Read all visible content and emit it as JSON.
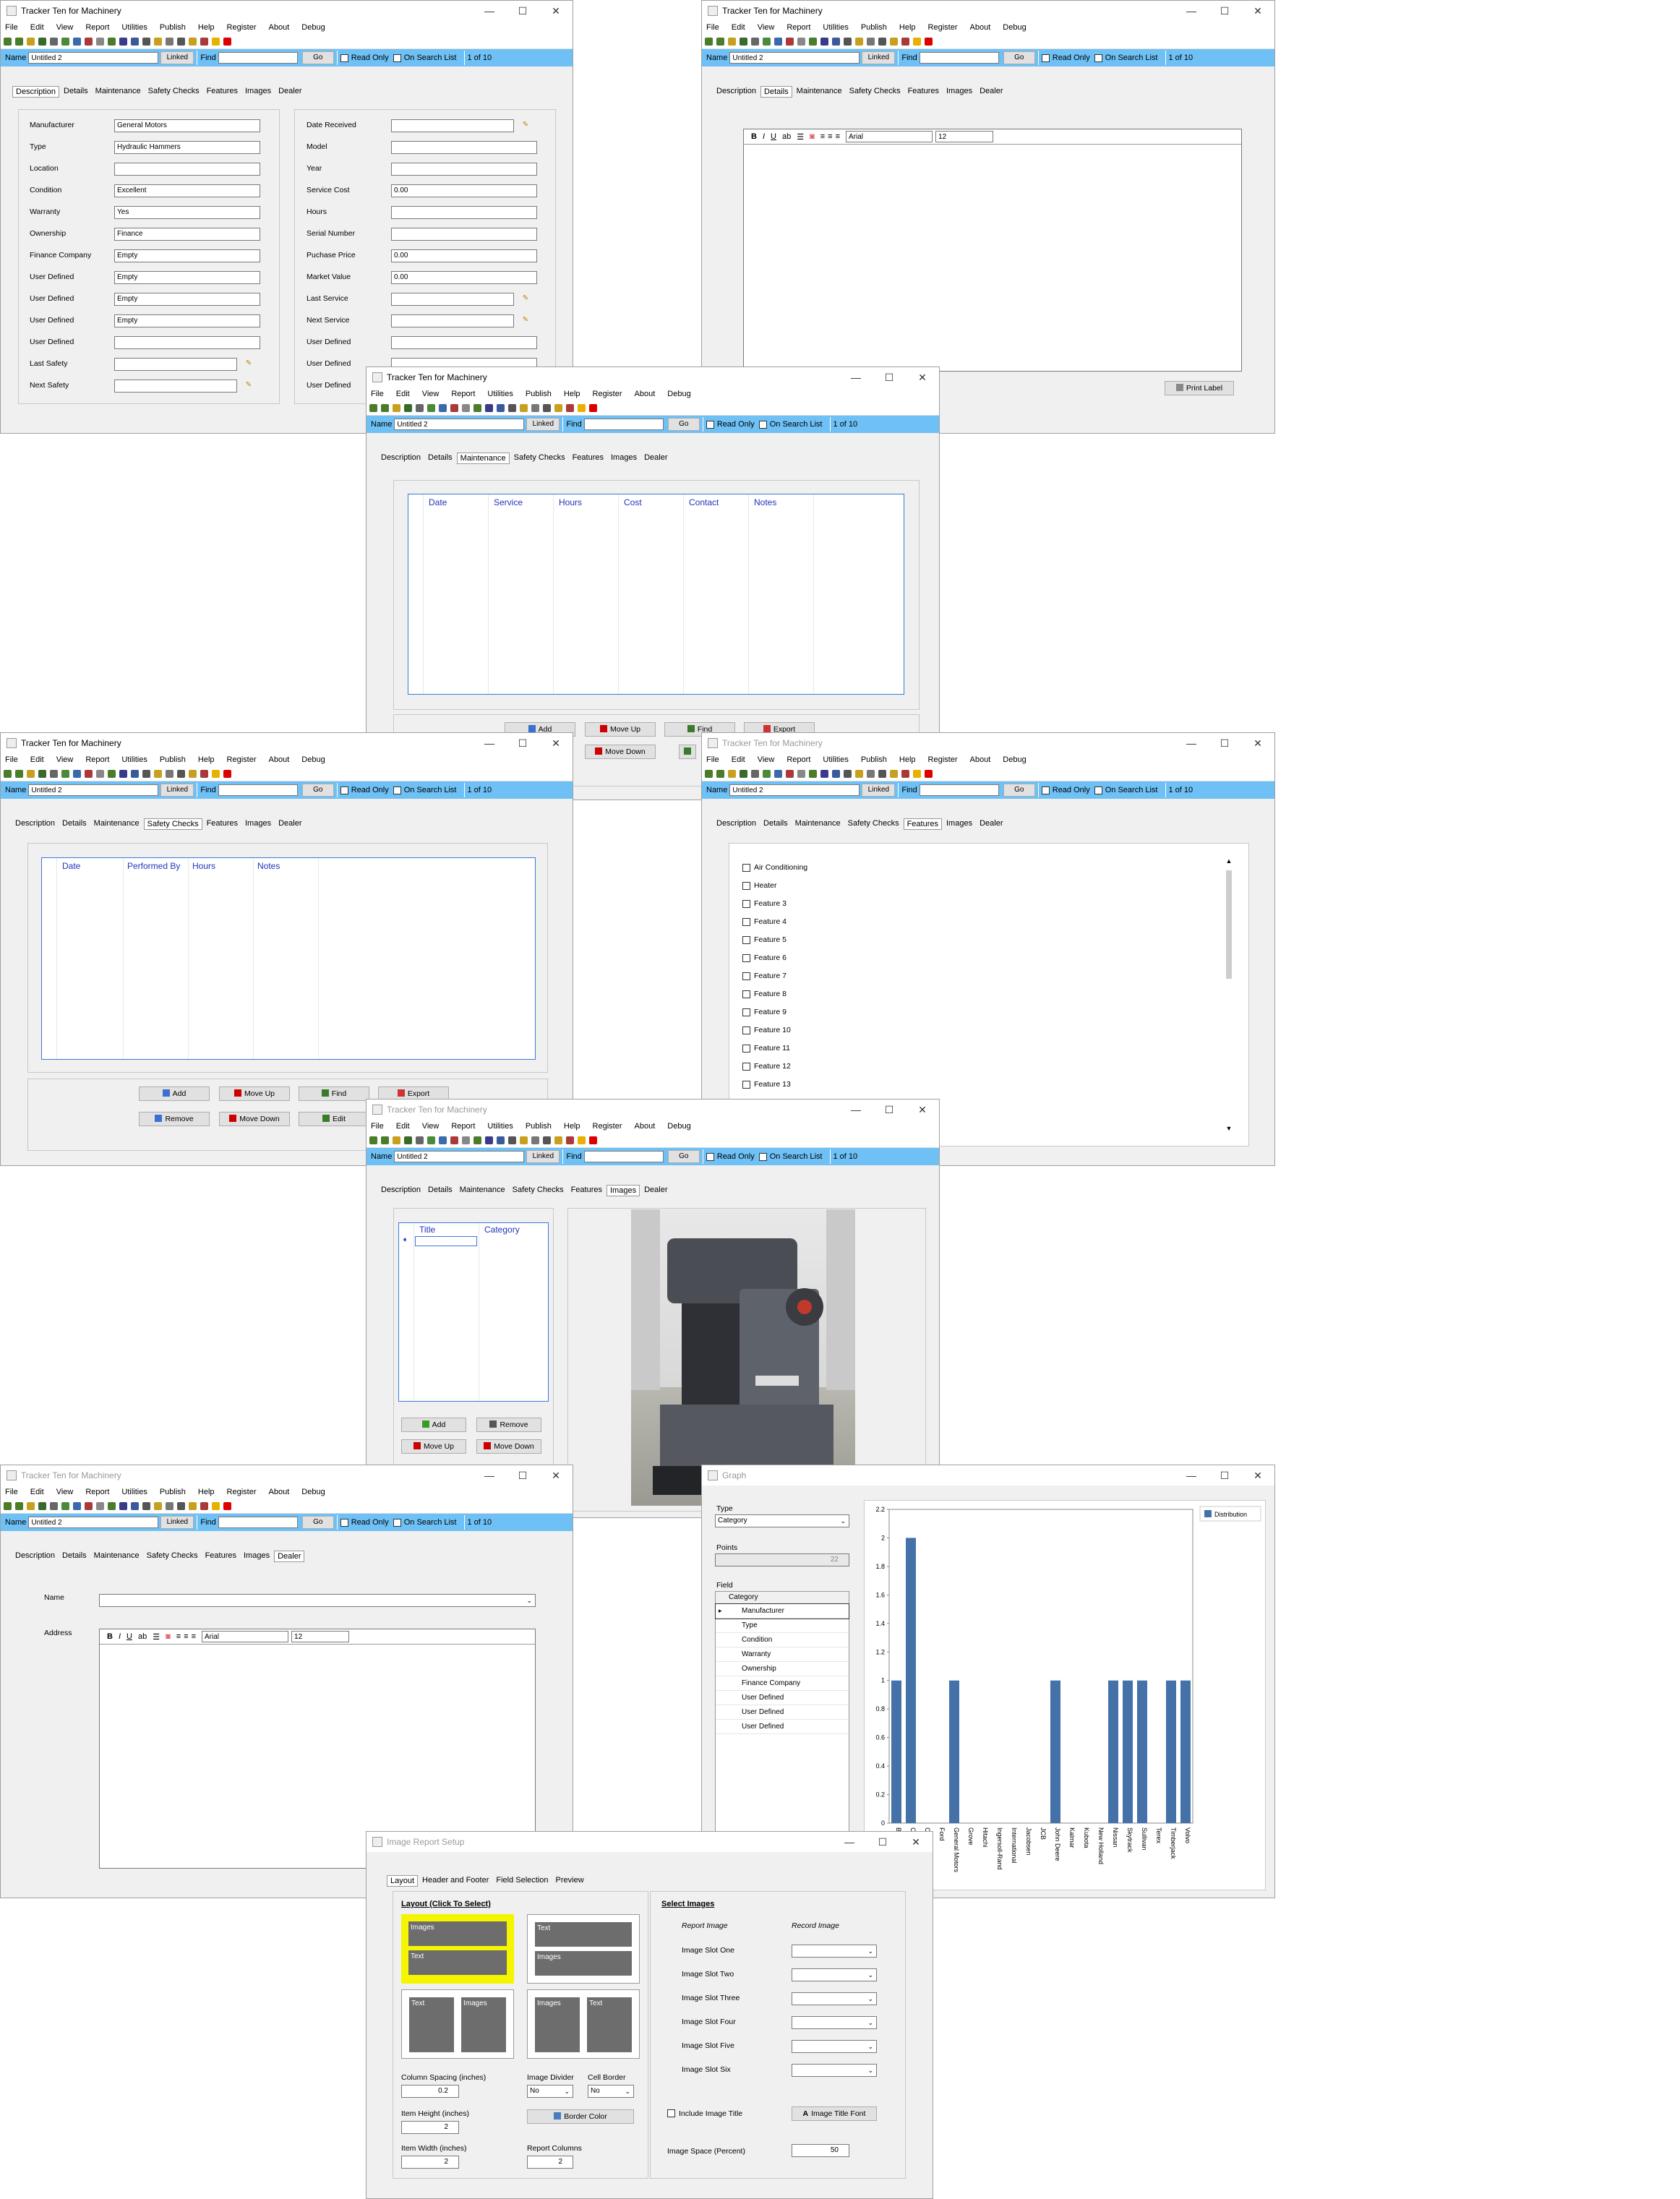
{
  "app": {
    "title": "Tracker Ten for Machinery",
    "menu": [
      "File",
      "Edit",
      "View",
      "Report",
      "Utilities",
      "Publish",
      "Help",
      "Register",
      "About",
      "Debug"
    ],
    "name_label": "Name",
    "name_value": "Untitled 2",
    "linked_label": "Linked",
    "find_label": "Find",
    "go_label": "Go",
    "readonly_label": "Read Only",
    "onsearch_label": "On Search List",
    "record_pos": "1 of 10",
    "tabs": [
      "Description",
      "Details",
      "Maintenance",
      "Safety Checks",
      "Features",
      "Images",
      "Dealer"
    ]
  },
  "description": {
    "left_fields": [
      {
        "label": "Manufacturer",
        "value": "General Motors"
      },
      {
        "label": "Type",
        "value": "Hydraulic Hammers"
      },
      {
        "label": "Location",
        "value": ""
      },
      {
        "label": "Condition",
        "value": "Excellent"
      },
      {
        "label": "Warranty",
        "value": "Yes"
      },
      {
        "label": "Ownership",
        "value": "Finance"
      },
      {
        "label": "Finance Company",
        "value": "Empty"
      },
      {
        "label": "User Defined",
        "value": "Empty"
      },
      {
        "label": "User Defined",
        "value": "Empty"
      },
      {
        "label": "User Defined",
        "value": "Empty"
      },
      {
        "label": "User Defined",
        "value": ""
      },
      {
        "label": "Last Safety",
        "value": ""
      },
      {
        "label": "Next Safety",
        "value": ""
      }
    ],
    "right_fields": [
      {
        "label": "Date Received",
        "value": ""
      },
      {
        "label": "Model",
        "value": ""
      },
      {
        "label": "Year",
        "value": ""
      },
      {
        "label": "Service Cost",
        "value": "0.00"
      },
      {
        "label": "Hours",
        "value": ""
      },
      {
        "label": "Serial Number",
        "value": ""
      },
      {
        "label": "Puchase Price",
        "value": "0.00"
      },
      {
        "label": "Market Value",
        "value": "0.00"
      },
      {
        "label": "Last Service",
        "value": ""
      },
      {
        "label": "Next Service",
        "value": ""
      },
      {
        "label": "User Defined",
        "value": ""
      },
      {
        "label": "User Defined",
        "value": ""
      },
      {
        "label": "User Defined",
        "value": ""
      }
    ]
  },
  "details": {
    "font": "Arial",
    "size": "12",
    "print_label": "Print Label"
  },
  "maintenance": {
    "columns": [
      "Date",
      "Service",
      "Hours",
      "Cost",
      "Contact",
      "Notes"
    ],
    "buttons": [
      "Add",
      "Move Up",
      "Find",
      "Export",
      "Move Down"
    ]
  },
  "safety": {
    "columns": [
      "Date",
      "Performed By",
      "Hours",
      "Notes"
    ],
    "buttons": [
      "Add",
      "Move Up",
      "Find",
      "Export",
      "Remove",
      "Move Down",
      "Edit"
    ]
  },
  "features": {
    "items": [
      "Air Conditioning",
      "Heater",
      "Feature 3",
      "Feature 4",
      "Feature 5",
      "Feature 6",
      "Feature 7",
      "Feature  8",
      "Feature  9",
      "Feature 10",
      "Feature 11",
      "Feature 12",
      "Feature 13"
    ]
  },
  "images": {
    "columns": [
      "Title",
      "Category"
    ],
    "buttons": [
      "Add",
      "Remove",
      "Move Up",
      "Move Down"
    ]
  },
  "dealer": {
    "name_label": "Name",
    "address_label": "Address",
    "font": "Arial",
    "size": "12"
  },
  "graph": {
    "title": "Graph",
    "type_label": "Type",
    "type_value": "Category",
    "points_label": "Points",
    "points_value": "22",
    "field_label": "Field",
    "field_header": "Category",
    "field_items": [
      "Manufacturer",
      "Type",
      "Condition",
      "Warranty",
      "Ownership",
      "Finance Company",
      "User Defined",
      "User Defined",
      "User Defined"
    ],
    "legend": "Distribution"
  },
  "chart_data": {
    "type": "bar",
    "categories": [
      "Bi",
      "Ca",
      "Ca",
      "Ford",
      "General Motors",
      "Grove",
      "Hitachi",
      "Ingersoll-Rand",
      "International",
      "Jacobsen",
      "JCB",
      "John Deere",
      "Kalmar",
      "Kubota",
      "New Holland",
      "Nissan",
      "Skytrack",
      "Sullivan",
      "Terex",
      "Timberjack",
      "Volvo"
    ],
    "values": [
      1,
      2,
      0,
      0,
      1,
      0,
      0,
      0,
      0,
      0,
      0,
      1,
      0,
      0,
      0,
      1,
      1,
      1,
      0,
      1,
      1
    ],
    "yticks": [
      "2.2",
      "2",
      "1.8",
      "1.6",
      "1.4",
      "1.2",
      "1",
      "0.8",
      "0.6",
      "0.4",
      "0.2",
      "0"
    ],
    "ylim": [
      0,
      2.2
    ],
    "legend": "Distribution"
  },
  "report": {
    "title": "Image Report Setup",
    "tabs": [
      "Layout",
      "Header and Footer",
      "Field Selection",
      "Preview"
    ],
    "layout_heading": "Layout (Click To Select)",
    "select_heading": "Select Images",
    "report_image": "Report Image",
    "record_image": "Record Image",
    "slots": [
      "Image Slot One",
      "Image Slot Two",
      "Image Slot Three",
      "Image Slot Four",
      "Image Slot Five",
      "Image Slot Six"
    ],
    "images_word": "Images",
    "text_word": "Text",
    "column_spacing_label": "Column Spacing (inches)",
    "column_spacing": "0.2",
    "image_divider_label": "Image Divider",
    "image_divider": "No",
    "cell_border_label": "Cell Border",
    "cell_border": "No",
    "item_height_label": "Item Height (inches)",
    "item_height": "2",
    "border_color": "Border Color",
    "item_width_label": "Item Width (inches)",
    "item_width": "2",
    "report_columns_label": "Report Columns",
    "report_columns": "2",
    "include_title": "Include Image Title",
    "title_font": "Image Title Font",
    "image_space_label": "Image Space (Percent)",
    "image_space": "50"
  }
}
